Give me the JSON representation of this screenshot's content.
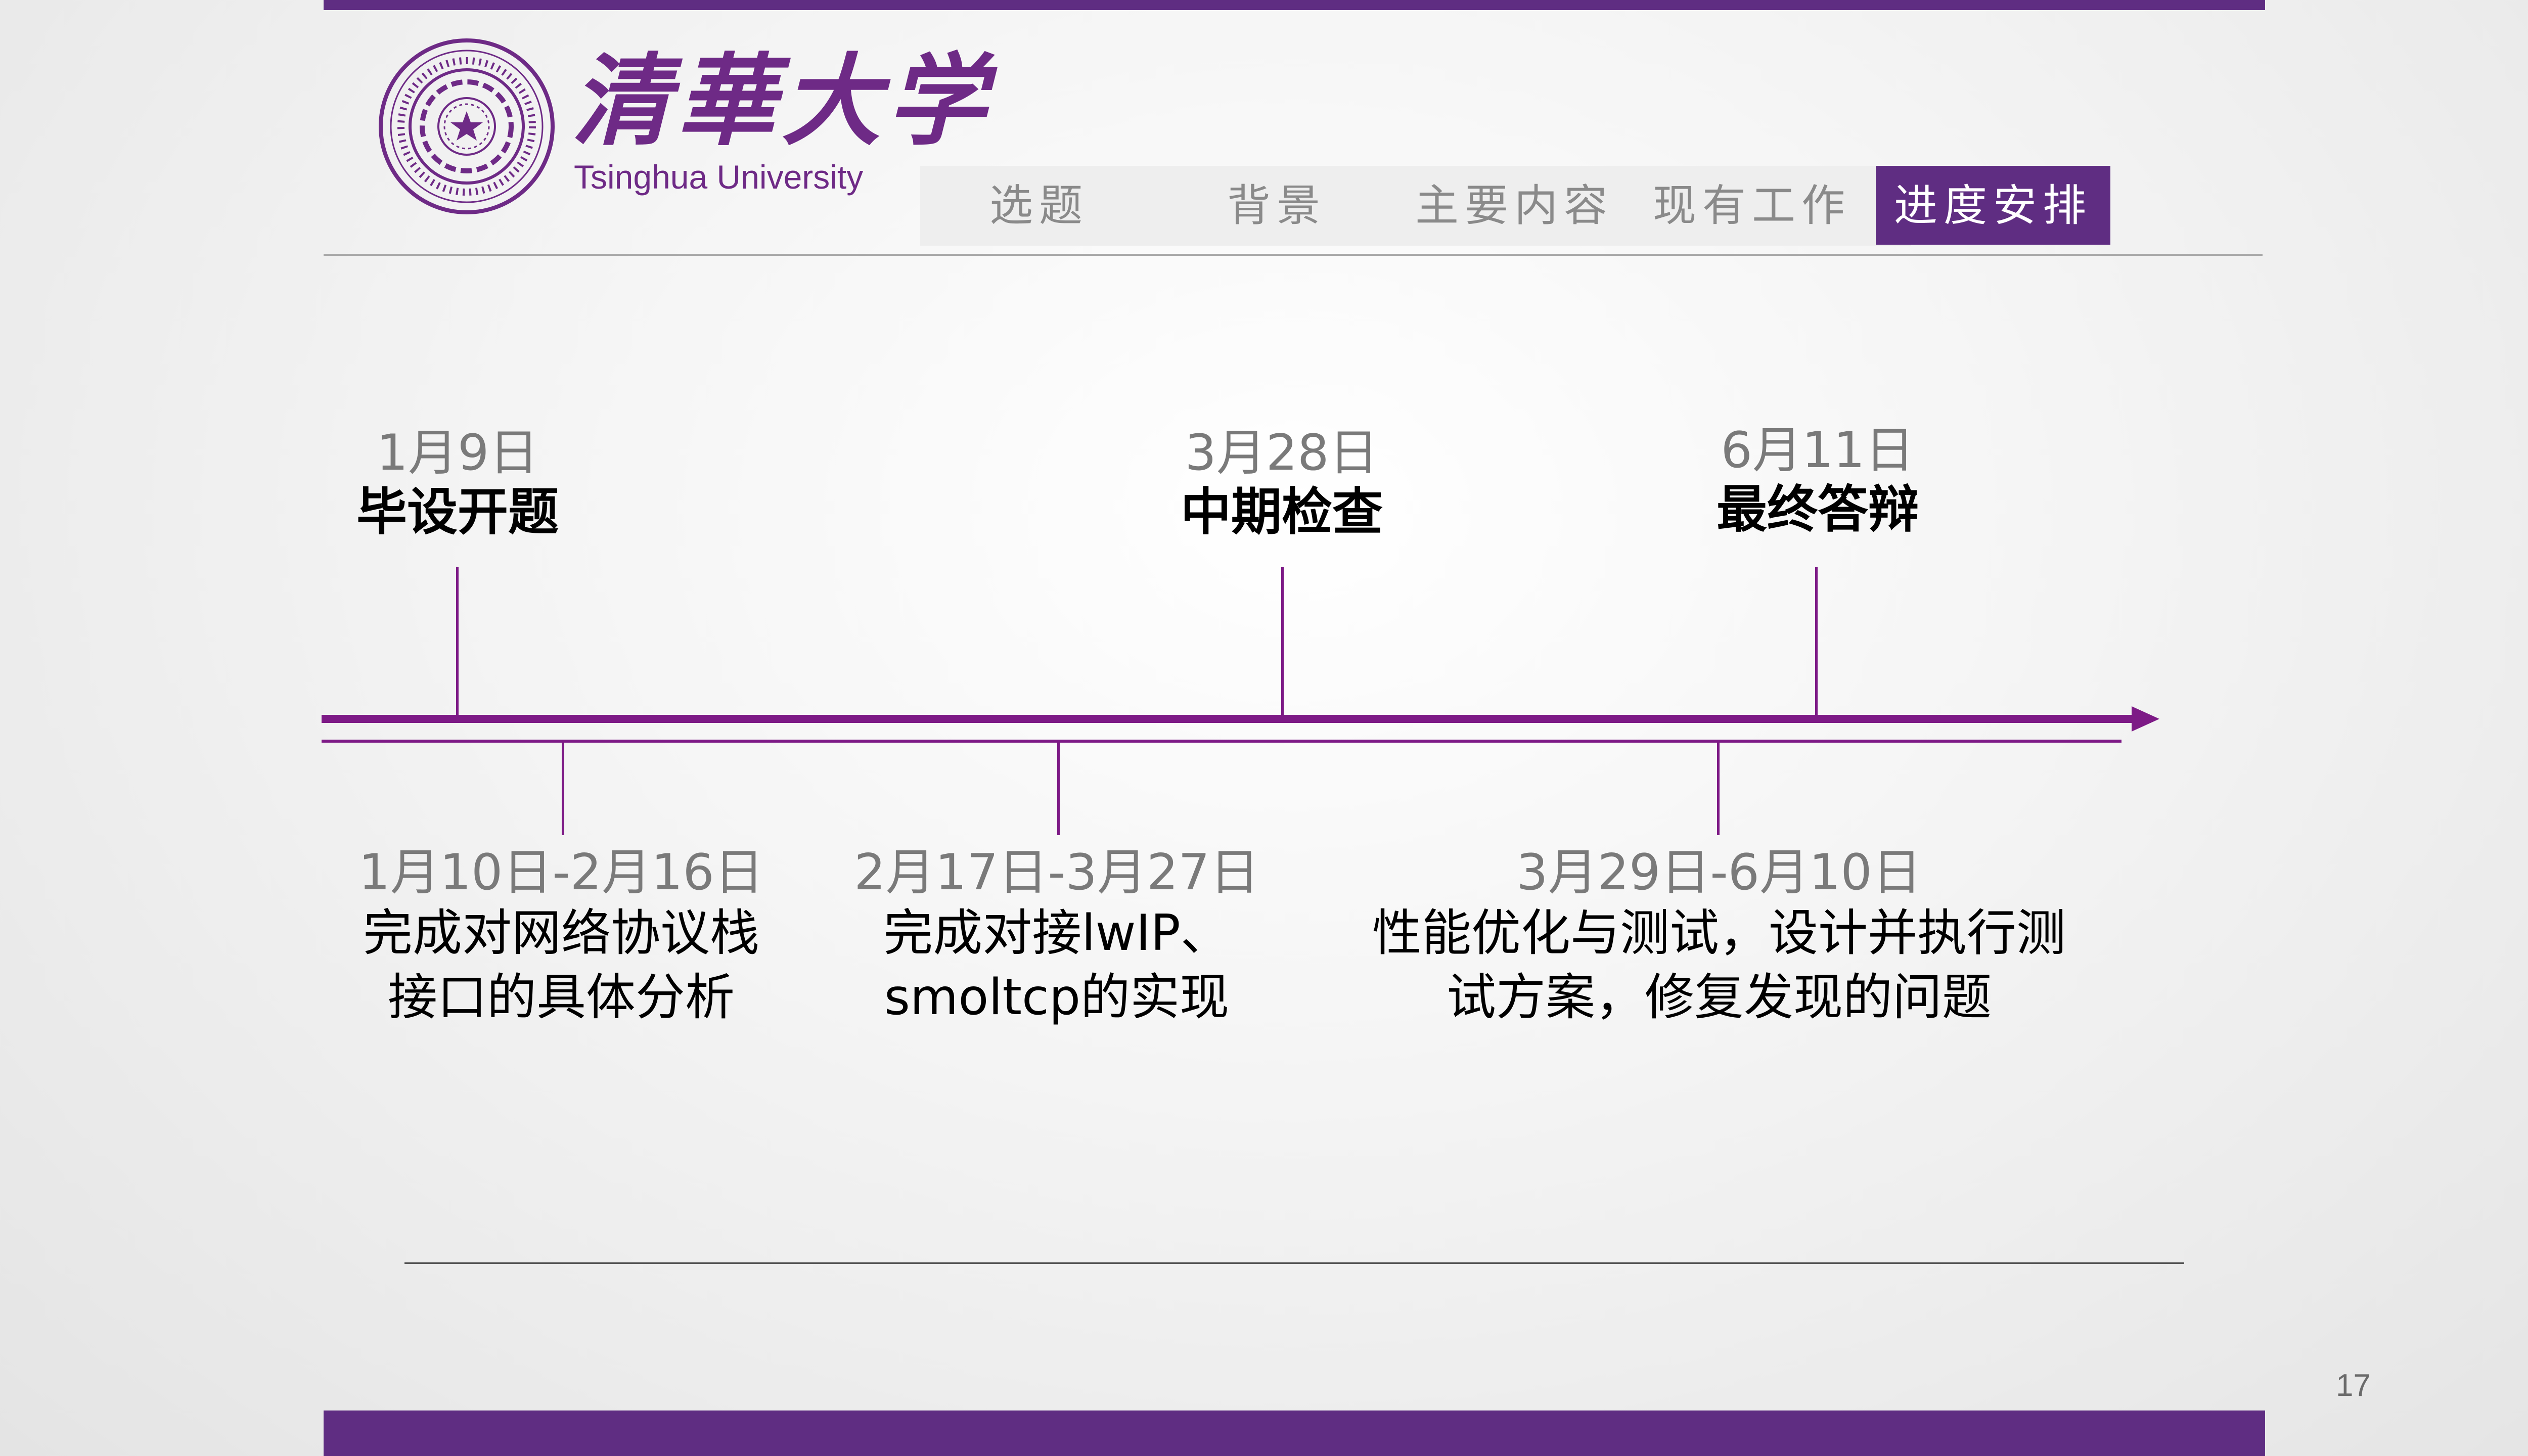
{
  "logo": {
    "name_cn": "清華大学",
    "name_en": "Tsinghua University",
    "seal_icon": "tsinghua-seal-icon"
  },
  "nav": {
    "tabs": [
      {
        "label": "选题"
      },
      {
        "label": "背景"
      },
      {
        "label": "主要内容"
      },
      {
        "label": "现有工作"
      },
      {
        "label": "进度安排",
        "active": true
      }
    ]
  },
  "timeline": {
    "upper": [
      {
        "date": "1月9日",
        "label": "毕设开题"
      },
      {
        "date": "3月28日",
        "label": "中期检查"
      },
      {
        "date": "6月11日",
        "label": "最终答辩"
      }
    ],
    "lower": [
      {
        "date": "1月10日-2月16日",
        "desc_line1": "完成对网络协议栈",
        "desc_line2": "接口的具体分析"
      },
      {
        "date": "2月17日-3月27日",
        "desc_line1": "完成对接lwIP、",
        "desc_line2": "smoltcp的实现"
      },
      {
        "date": "3月29日-6月10日",
        "desc_line1": "性能优化与测试，设计并执行测",
        "desc_line2": "试方案，修复发现的问题"
      }
    ]
  },
  "page_number": "17",
  "colors": {
    "brand_purple": "#5f2d82",
    "timeline_purple": "#7d1a86"
  }
}
